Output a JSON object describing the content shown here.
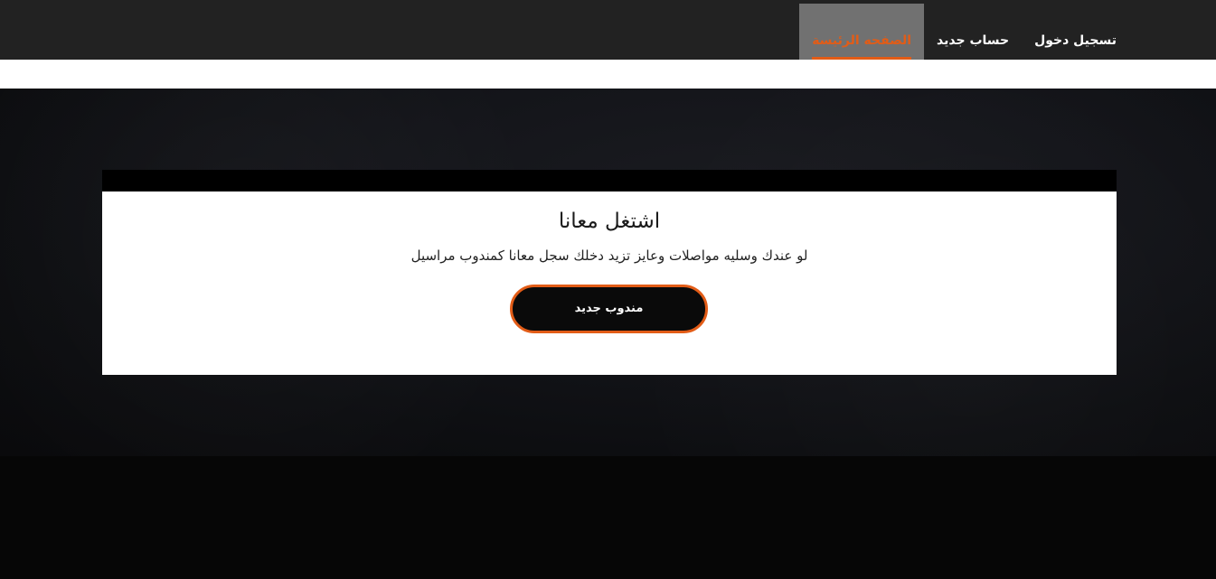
{
  "navbar": {
    "items": [
      {
        "label": "تسجيل دخول",
        "active": false
      },
      {
        "label": "حساب جديد",
        "active": false
      },
      {
        "label": "الصفحه الرئيسة",
        "active": true
      }
    ]
  },
  "card": {
    "title": "اشتغل معانا",
    "text": "لو عندك وسليه مواصلات وعايز تزيد دخلك سجل معانا كمندوب مراسيل",
    "button_label": "مندوب جديد"
  },
  "colors": {
    "accent": "#e25c17",
    "navbar_bg": "#222222",
    "active_tab_bg": "#717171"
  }
}
